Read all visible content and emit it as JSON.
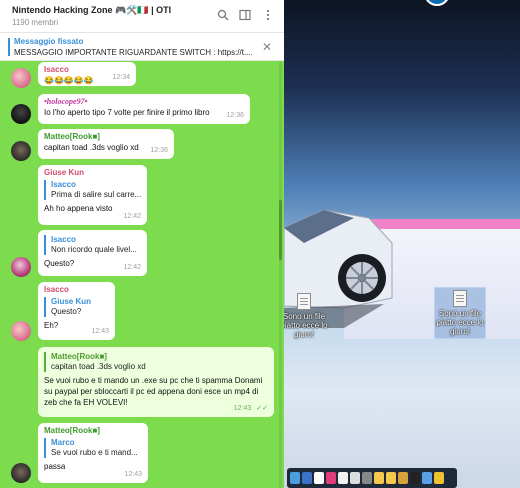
{
  "telegram": {
    "title": "Nintendo Hacking Zone 🎮🛠️🇮🇹 | OTI",
    "members": "1190 membri",
    "pinned": {
      "title": "Messaggio fissato",
      "text": "MESSAGGIO IMPORTANTE RIGUARDANTE SWITCH : https://t...."
    },
    "messages": [
      {
        "sender": "Isacco",
        "text": "😂😂😂😂😂",
        "time": "12:34"
      },
      {
        "sender": "•holocope97•",
        "text": "Io l'ho aperto tipo 7 volte per finire il primo libro",
        "time": "12:36"
      },
      {
        "sender": "Matteo[Rook■]",
        "text": "capitan toad .3ds voglio xd",
        "time": "12:36"
      },
      {
        "sender": "Giuse Kun",
        "quote_name": "Isacco",
        "quote_text": "Prima di salire sul carre...",
        "text": "Ah ho appena visto",
        "time": "12:42"
      },
      {
        "quote_name": "Isacco",
        "quote_text": "Non ricordo quale livel...",
        "text": "Questo?",
        "time": "12:42"
      },
      {
        "sender": "Isacco",
        "quote_name": "Giuse Kun",
        "quote_text": "Questo?",
        "text": "Eh?",
        "time": "12:43"
      },
      {
        "quote_name": "Matteo[Rook■]",
        "quote_text": "capitan toad .3ds voglio xd",
        "text": "Se vuoi rubo e ti mando un .exe su pc che ti spamma Donami su paypal per sbloccarti il pc ed appena doni esce un mp4 di zeb che fa EH VOLEVI!",
        "time": "12:43",
        "checks": "✓✓"
      },
      {
        "sender": "Matteo[Rook■]",
        "quote_name": "Marco",
        "quote_text": "Se vuoi rubo e ti mand...",
        "text": "passa",
        "time": "12:43"
      }
    ]
  },
  "desktop": {
    "icon1_label": "Sono un file piatto ecce lo giuro!",
    "icon2_label": "Sono un file piatto ecce lo giuro!"
  },
  "colors": {
    "chat_bg": "#7ddc4d",
    "accent": "#3a8fd7",
    "outgoing": "#eeffde"
  }
}
